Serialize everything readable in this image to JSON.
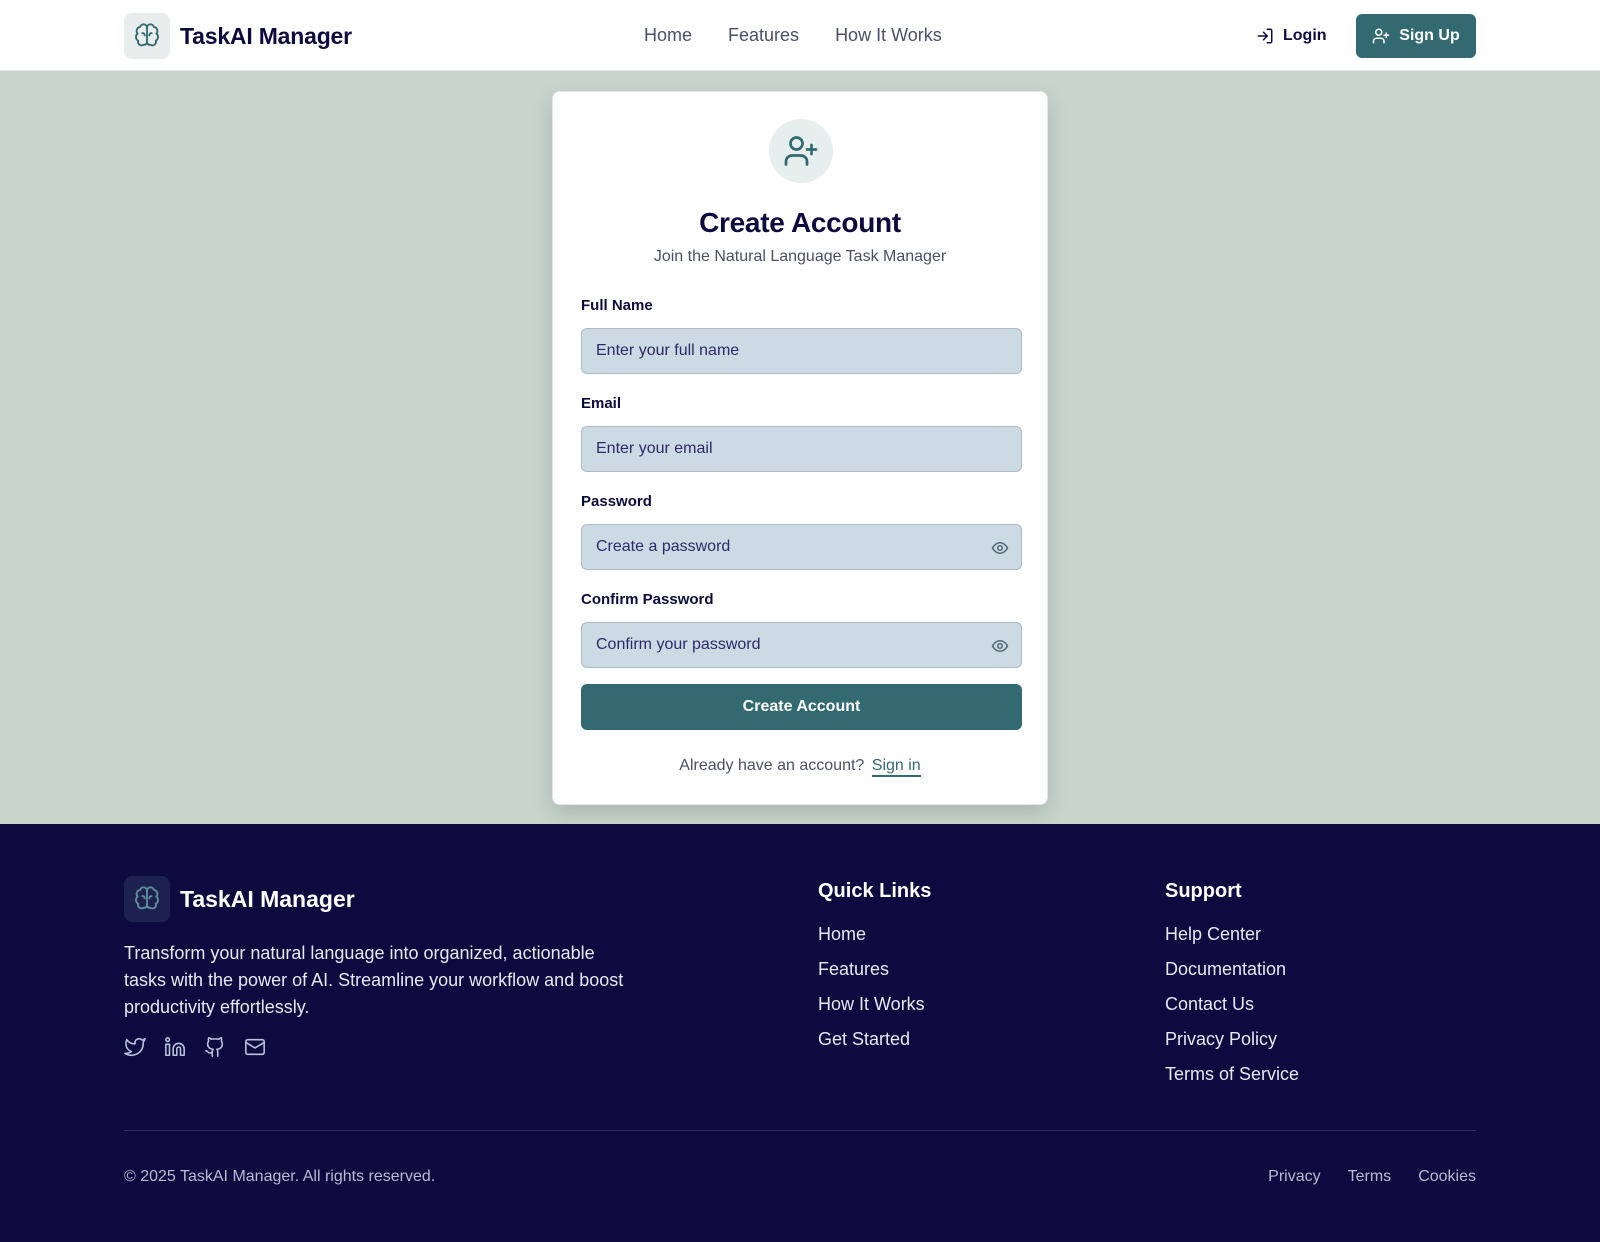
{
  "header": {
    "brand": "TaskAI Manager",
    "nav": [
      "Home",
      "Features",
      "How It Works"
    ],
    "login_label": "Login",
    "signup_label": "Sign Up"
  },
  "form": {
    "title": "Create Account",
    "subtitle": "Join the Natural Language Task Manager",
    "fields": [
      {
        "label": "Full Name",
        "placeholder": "Enter your full name",
        "value": ""
      },
      {
        "label": "Email",
        "placeholder": "Enter your email",
        "value": ""
      },
      {
        "label": "Password",
        "placeholder": "Create a password",
        "value": ""
      },
      {
        "label": "Confirm Password",
        "placeholder": "Confirm your password",
        "value": ""
      }
    ],
    "submit_label": "Create Account",
    "already_text": "Already have an account?",
    "signin_label": "Sign in"
  },
  "footer": {
    "brand": "TaskAI Manager",
    "description": "Transform your natural language into organized, actionable tasks with the power of AI. Streamline your workflow and boost productivity effortlessly.",
    "socials": [
      "twitter-icon",
      "linkedin-icon",
      "github-icon",
      "mail-icon"
    ],
    "quick_links": {
      "title": "Quick Links",
      "items": [
        "Home",
        "Features",
        "How It Works",
        "Get Started"
      ]
    },
    "support": {
      "title": "Support",
      "items": [
        "Help Center",
        "Documentation",
        "Contact Us",
        "Privacy Policy",
        "Terms of Service"
      ]
    },
    "copyright": "© 2025 TaskAI Manager. All rights reserved.",
    "legal": [
      "Privacy",
      "Terms",
      "Cookies"
    ]
  },
  "colors": {
    "accent": "#336a72",
    "navy": "#0c0a3e",
    "background": "#c9d5cb",
    "input_bg": "#ccdae4"
  }
}
